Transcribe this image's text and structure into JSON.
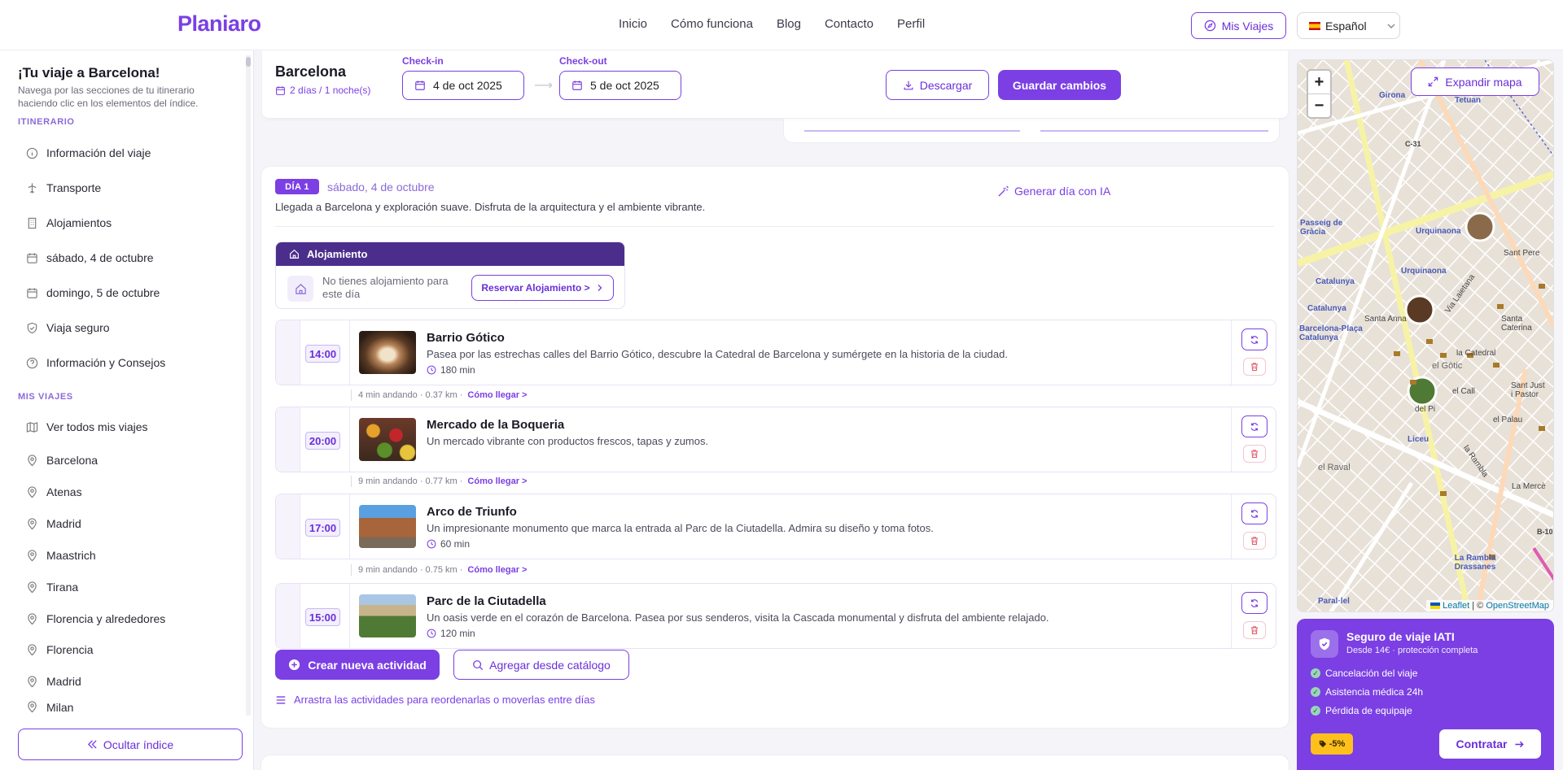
{
  "header": {
    "logo": "Planiaro",
    "nav": [
      "Inicio",
      "Cómo funciona",
      "Blog",
      "Contacto",
      "Perfil"
    ],
    "my_trips_label": "Mis Viajes",
    "language": "Español"
  },
  "sidebar": {
    "title": "¡Tu viaje a Barcelona!",
    "subtitle": "Navega por las secciones de tu itinerario haciendo clic en los elementos del índice.",
    "itinerary_heading": "ITINERARIO",
    "itinerary": [
      {
        "label": "Información del viaje",
        "icon": "info-icon"
      },
      {
        "label": "Transporte",
        "icon": "plane-icon"
      },
      {
        "label": "Alojamientos",
        "icon": "building-icon"
      },
      {
        "label": "sábado, 4 de octubre",
        "icon": "calendar-icon"
      },
      {
        "label": "domingo, 5 de octubre",
        "icon": "calendar-icon"
      },
      {
        "label": "Viaja seguro",
        "icon": "shield-icon"
      },
      {
        "label": "Información y Consejos",
        "icon": "help-icon"
      }
    ],
    "trips_heading": "MIS VIAJES",
    "trips": [
      "Ver todos mis viajes",
      "Barcelona",
      "Atenas",
      "Madrid",
      "Maastrich",
      "Tirana",
      "Florencia y alrededores",
      "Florencia",
      "Madrid",
      "Milan"
    ],
    "hide_label": "Ocultar índice"
  },
  "topbar": {
    "city": "Barcelona",
    "duration": "2 días / 1 noche(s)",
    "checkin_label": "Check-in",
    "checkin": "4 de oct 2025",
    "checkout_label": "Check-out",
    "checkout": "5 de oct 2025",
    "download_label": "Descargar",
    "save_label": "Guardar cambios"
  },
  "day": {
    "badge": "DÍA 1",
    "date": "sábado, 4 de octubre",
    "description": "Llegada a Barcelona y exploración suave. Disfruta de la arquitectura y el ambiente vibrante.",
    "generate_label": "Generar día con IA",
    "accommodation": {
      "heading": "Alojamiento",
      "empty_text": "No tienes alojamiento para este día",
      "reserve_label": "Reservar Alojamiento >"
    },
    "activities": [
      {
        "time": "14:00",
        "name": "Barrio Gótico",
        "description": "Pasea por las estrechas calles del Barrio Gótico, descubre la Catedral de Barcelona y sumérgete en la historia de la ciudad.",
        "duration": "180 min"
      },
      {
        "time": "20:00",
        "name": "Mercado de la Boqueria",
        "description": "Un mercado vibrante con productos frescos, tapas y zumos.",
        "duration": ""
      },
      {
        "time": "17:00",
        "name": "Arco de Triunfo",
        "description": "Un impresionante monumento que marca la entrada al Parc de la Ciutadella. Admira su diseño y toma fotos.",
        "duration": "60 min"
      },
      {
        "time": "15:00",
        "name": "Parc de la Ciutadella",
        "description": "Un oasis verde en el corazón de Barcelona. Pasea por sus senderos, visita la Cascada monumental y disfruta del ambiente relajado.",
        "duration": "120 min"
      }
    ],
    "walks": [
      {
        "text": "4 min andando · 0.37 km ·",
        "link": "Cómo llegar >"
      },
      {
        "text": "9 min andando · 0.77 km ·",
        "link": "Cómo llegar >"
      },
      {
        "text": "9 min andando · 0.75 km ·",
        "link": "Cómo llegar >"
      }
    ],
    "create_label": "Crear nueva actividad",
    "catalog_label": "Agregar desde catálogo",
    "drag_hint": "Arrastra las actividades para reordenarlas o moverlas entre días"
  },
  "map": {
    "zoom_in": "+",
    "zoom_out": "−",
    "expand_label": "Expandir mapa",
    "attribution_leaflet": "Leaflet",
    "attribution_sep": " | © ",
    "attribution_osm": "OpenStreetMap",
    "labels": [
      "Girona",
      "Tetuan",
      "C-31",
      "Passeig de Gràcia",
      "Urquinaona",
      "Urquinaona",
      "Sant Pere",
      "Catalunya",
      "Catalunya",
      "Via Laietana",
      "Santa Anna",
      "Santa Caterina",
      "Barcelona-Plaça Catalunya",
      "la Catedral",
      "el Gòtic",
      "Sant Just i Pastor",
      "el Call",
      "del Pi",
      "el Palau",
      "Liceu",
      "el Raval",
      "la Rambla",
      "La Mercè",
      "B-10",
      "La Rambla Drassanes",
      "Paral·lel"
    ]
  },
  "insurance": {
    "title": "Seguro de viaje IATI",
    "subtitle": "Desde 14€ · protección completa",
    "features": [
      "Cancelación del viaje",
      "Asistencia médica 24h",
      "Pérdida de equipaje"
    ],
    "discount": "-5%",
    "cta": "Contratar"
  },
  "colors": {
    "accent": "#7b3fe4",
    "accent_dark": "#4b2e8c",
    "discount": "#ffc01e"
  }
}
